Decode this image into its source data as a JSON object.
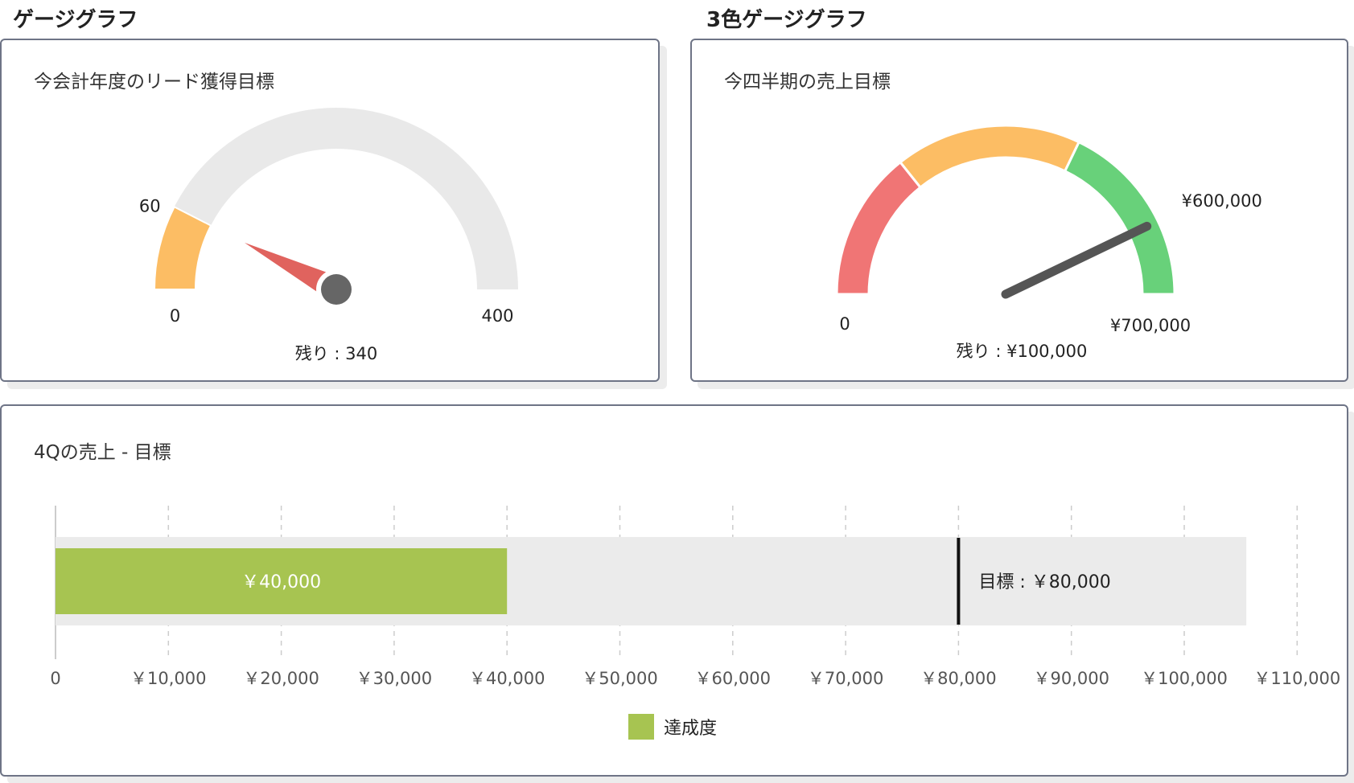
{
  "sections": {
    "gauge_title": "ゲージグラフ",
    "three_color_title": "3色ゲージグラフ"
  },
  "colors": {
    "track": "#e9e9e9",
    "orange": "#fcbd64",
    "red": "#f07575",
    "green": "#68d17a",
    "needle_red": "#e0635e",
    "needle_dark": "#555555",
    "bar_green": "#a7c451",
    "bullet_bg": "#ebebeb",
    "target_line": "#111111"
  },
  "chart_data": [
    {
      "type": "gauge",
      "title": "今会計年度のリード獲得目標",
      "min": 0,
      "max": 400,
      "value": 60,
      "min_label": "0",
      "max_label": "400",
      "value_label": "60",
      "remaining_text": "残り : 340"
    },
    {
      "type": "gauge",
      "title": "今四半期の売上目標",
      "min": 0,
      "max": 700000,
      "value": 600000,
      "bands": [
        {
          "from": 0,
          "to": 200000,
          "color": "#f07575"
        },
        {
          "from": 200000,
          "to": 450000,
          "color": "#fcbd64"
        },
        {
          "from": 450000,
          "to": 700000,
          "color": "#68d17a"
        }
      ],
      "min_label": "0",
      "max_label": "¥700,000",
      "value_label": "¥600,000",
      "remaining_text": "残り : ¥100,000"
    },
    {
      "type": "bar",
      "title": "4Qの売上 - 目標",
      "value": 40000,
      "value_label": "￥40,000",
      "target": 80000,
      "target_label": "目標 : ￥80,000",
      "xlim": [
        0,
        110000
      ],
      "range_max": 105500,
      "ticks": [
        0,
        10000,
        20000,
        30000,
        40000,
        50000,
        60000,
        70000,
        80000,
        90000,
        100000,
        110000
      ],
      "tick_labels": [
        "0",
        "￥10,000",
        "￥20,000",
        "￥30,000",
        "￥40,000",
        "￥50,000",
        "￥60,000",
        "￥70,000",
        "￥80,000",
        "￥90,000",
        "￥100,000",
        "￥110,000"
      ],
      "grid": true,
      "legend": "達成度",
      "legend_placement": "bottom"
    }
  ]
}
